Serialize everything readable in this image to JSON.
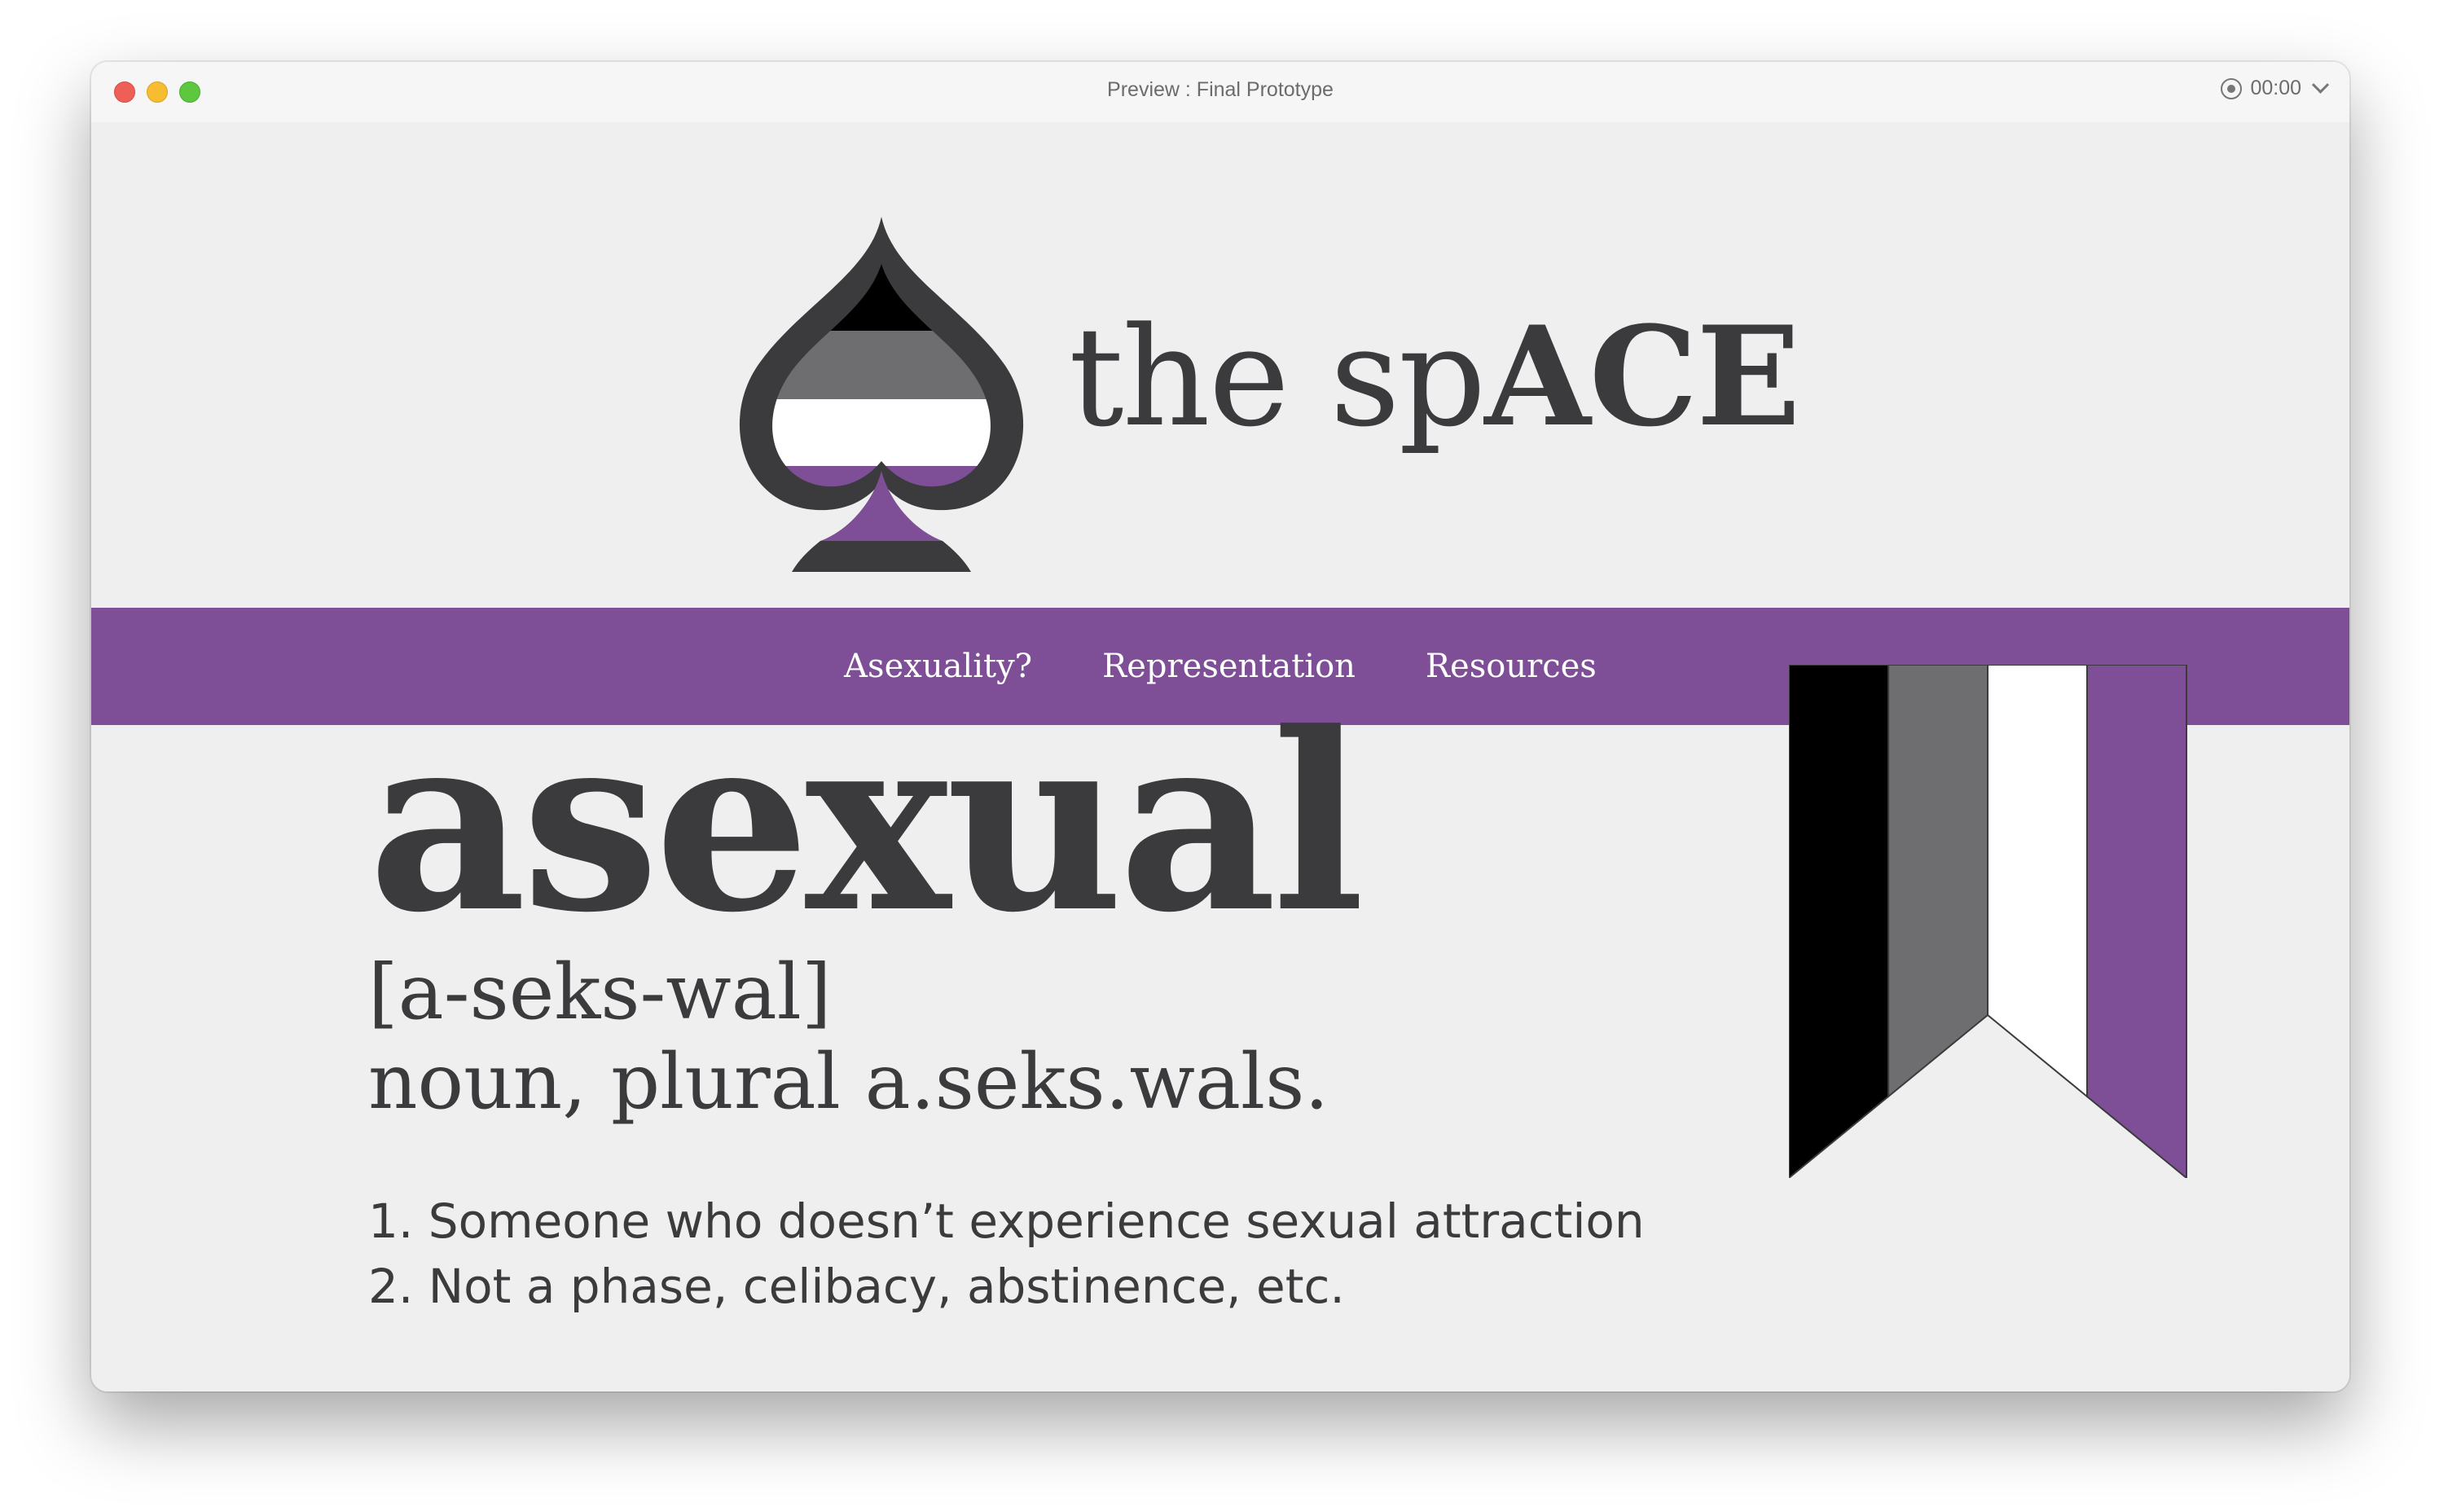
{
  "window": {
    "title": "Preview : Final Prototype",
    "timer": "00:00"
  },
  "brand": {
    "prefix": "the sp",
    "suffix": "ACE",
    "logo_icon": "spade-icon"
  },
  "nav": {
    "items": [
      {
        "label": "Asexuality?"
      },
      {
        "label": "Representation"
      },
      {
        "label": "Resources"
      }
    ]
  },
  "definition": {
    "word": "asexual",
    "pronunciation": "[a-seks-wal]",
    "part_of_speech": "noun, plural a.seks.wals.",
    "senses": [
      "1. Someone who doesn’t experience sexual attraction",
      "2. Not a phase, celibacy, abstinence, etc."
    ]
  },
  "colors": {
    "purple": "#7e4f96",
    "black": "#000000",
    "gray": "#6e6e70",
    "white": "#ffffff",
    "text": "#3b3b3d",
    "background": "#efefef"
  }
}
